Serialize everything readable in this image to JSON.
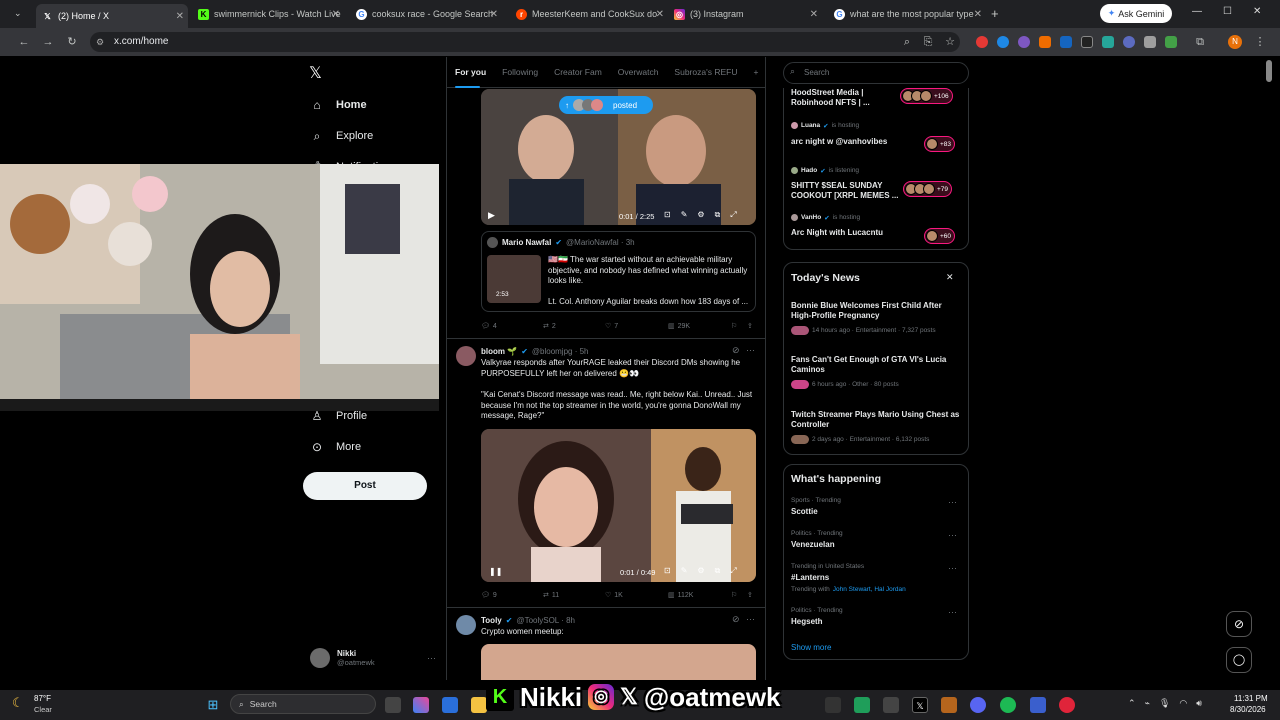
{
  "browser": {
    "tabs": [
      {
        "title": "(2) Home / X",
        "icon": "x-logo-icon",
        "active": true
      },
      {
        "title": "swimmernick Clips - Watch Live",
        "icon": "kick-icon"
      },
      {
        "title": "cooksux race - Google Search",
        "icon": "google-icon"
      },
      {
        "title": "MeesterKeem and CookSux do",
        "icon": "reddit-icon"
      },
      {
        "title": "(3) Instagram",
        "icon": "instagram-icon"
      },
      {
        "title": "what are the most popular type",
        "icon": "gemini-icon"
      }
    ],
    "new_tab": "+",
    "ask_gemini": "Ask Gemini",
    "url": "x.com/home"
  },
  "left_nav": {
    "logo": "𝕏",
    "items": [
      {
        "label": "Home",
        "icon": "home-icon"
      },
      {
        "label": "Explore",
        "icon": "search-icon"
      },
      {
        "label": "Notifications",
        "icon": "bell-icon"
      },
      {
        "label": "Profile",
        "icon": "person-icon"
      },
      {
        "label": "More",
        "icon": "more-circle-icon"
      }
    ],
    "post_button": "Post",
    "account": {
      "name": "Nikki",
      "handle": "@oatmewk"
    }
  },
  "feed": {
    "tabs": [
      "For you",
      "Following",
      "Creator Fam",
      "Overwatch",
      "Subroza's REFU"
    ],
    "posted_pill": "posted",
    "video1": {
      "time": "0:01 / 2:25"
    },
    "quote": {
      "author": "Mario Nawfal",
      "handle": "@MarioNawfal · 3h",
      "text": "🇺🇸🇮🇷 The war started without an achievable military objective, and nobody has defined what winning actually looks like.",
      "text2": "Lt. Col. Anthony Aguilar breaks down how 183 days of ...",
      "duration": "2:53"
    },
    "post1_actions": {
      "replies": "4",
      "reposts": "2",
      "likes": "7",
      "views": "29K"
    },
    "post2": {
      "author": "bloom 🌱",
      "handle": "@bloomjpg · 5h",
      "text": "Valkyrae responds after YourRAGE leaked their Discord DMs showing he PURPOSEFULLY left her on delivered 😬👀",
      "quote": "\"Kai Cenat's Discord message was read.. Me, right below Kai.. Unread.. Just because I'm not the top streamer in the world, you're gonna DonoWall my message, Rage?\"",
      "video_time": "0:01 / 0:49",
      "replies": "9",
      "reposts": "11",
      "likes": "1K",
      "views": "112K"
    },
    "post3": {
      "author": "Tooly",
      "handle": "@ToolySOL · 8h",
      "text": "Crypto women meetup:"
    }
  },
  "right": {
    "search_placeholder": "Search",
    "spaces": [
      {
        "title": "HoodStreet Media | Robinhood NFTS | ...",
        "count": "+106"
      },
      {
        "host": "Luana",
        "status": "is hosting",
        "title": "arc night w @vanhovibes",
        "count": "+83"
      },
      {
        "host": "Hado",
        "status": "is listening",
        "title": "SHITTY $SEAL SUNDAY COOKOUT [XRPL MEMES ...",
        "count": "+79"
      },
      {
        "host": "VanHo",
        "status": "is hosting",
        "title": "Arc Night with Lucacntu",
        "count": "+60"
      }
    ],
    "news": {
      "title": "Today's News",
      "items": [
        {
          "headline": "Bonnie Blue Welcomes First Child After High-Profile Pregnancy",
          "meta": "14 hours ago · Entertainment · 7,327 posts"
        },
        {
          "headline": "Fans Can't Get Enough of GTA VI's Lucia Caminos",
          "meta": "6 hours ago · Other · 80 posts"
        },
        {
          "headline": "Twitch Streamer Plays Mario Using Chest as Controller",
          "meta": "2 days ago · Entertainment · 6,132 posts"
        }
      ]
    },
    "happening": {
      "title": "What's happening",
      "items": [
        {
          "context": "Sports · Trending",
          "topic": "Scottie"
        },
        {
          "context": "Politics · Trending",
          "topic": "Venezuelan"
        },
        {
          "context": "Trending in United States",
          "topic": "#Lanterns",
          "sub": "Trending with",
          "with": "John Stewart, Hal Jordan"
        },
        {
          "context": "Politics · Trending",
          "topic": "Hegseth"
        }
      ],
      "show_more": "Show more"
    }
  },
  "overlay": {
    "tag": "Nikki",
    "handle": "@oatmewk"
  },
  "taskbar": {
    "weather_temp": "87°F",
    "weather_desc": "Clear",
    "search": "Search",
    "time": "11:31 PM",
    "date": "8/30/2026"
  },
  "colors": {
    "accent": "#1d9bf0",
    "live": "#f91880",
    "bg": "#000000"
  }
}
